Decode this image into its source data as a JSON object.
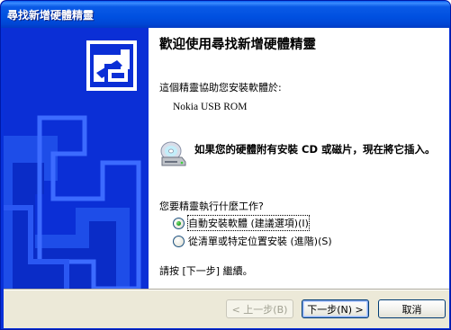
{
  "window": {
    "title": "尋找新增硬體精靈"
  },
  "content": {
    "heading": "歡迎使用尋找新增硬體精靈",
    "intro": "這個精靈協助您安裝軟體於:",
    "device": "Nokia USB ROM",
    "cd_prompt": "如果您的硬體附有安裝 CD 或磁片，現在將它插入。",
    "question": "您要精靈執行什麼工作?",
    "options": [
      {
        "label": "自動安裝軟體 (建議選項)(I)",
        "selected": true
      },
      {
        "label": "從清單或特定位置安裝 (進階)(S)",
        "selected": false
      }
    ],
    "footer": "請按 [下一步] 繼續。"
  },
  "buttons": {
    "back": "< 上一步(B)",
    "next": "下一步(N) >",
    "cancel": "取消"
  },
  "colors": {
    "banner": "#0b2fd6",
    "title_bar": "#0050e0",
    "dialog_bg": "#ece9d8"
  }
}
